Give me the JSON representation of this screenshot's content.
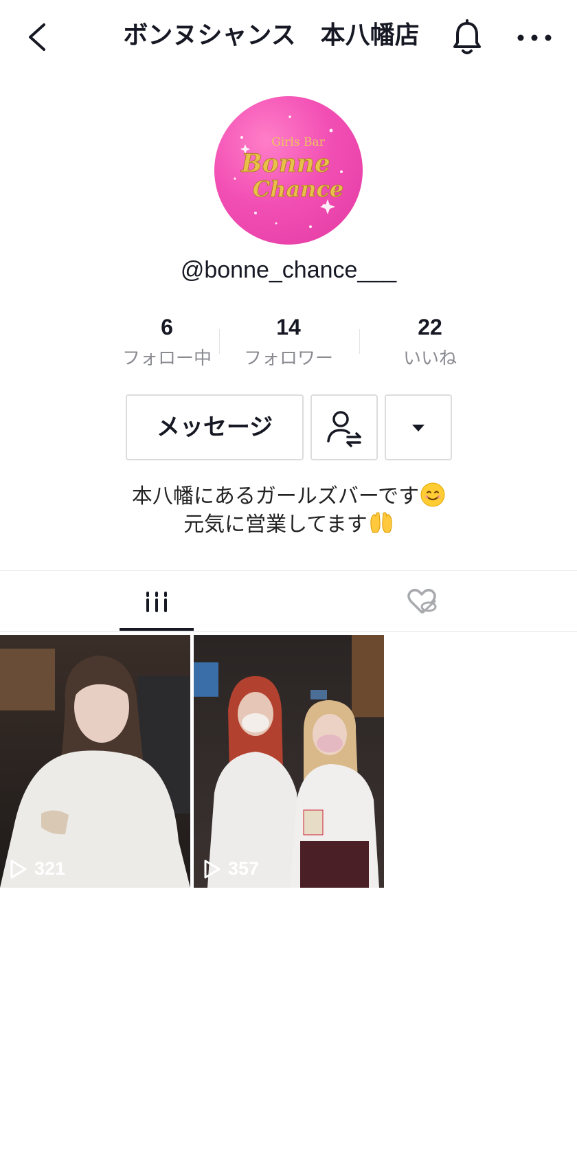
{
  "header": {
    "title": "ボンヌシャンス　本八幡店",
    "back_icon": "chevron-left-icon",
    "bell_icon": "bell-icon",
    "more_icon": "more-dots-icon"
  },
  "profile": {
    "username": "@bonne_chance___",
    "avatar_logo": {
      "line1": "Girls Bar",
      "line2": "Bonne",
      "line3": "Chance"
    }
  },
  "stats": [
    {
      "value": "6",
      "label": "フォロー中"
    },
    {
      "value": "14",
      "label": "フォロワー"
    },
    {
      "value": "22",
      "label": "いいね"
    }
  ],
  "actions": {
    "message_label": "メッセージ",
    "follow_icon": "user-switch-icon",
    "dropdown_icon": "triangle-down-icon"
  },
  "bio": {
    "line1": "本八幡にあるガールズバーです",
    "line2": "元気に営業してます"
  },
  "tabs": {
    "videos_icon": "grid-bars-icon",
    "liked_icon": "hidden-heart-icon"
  },
  "videos": [
    {
      "views": "321"
    },
    {
      "views": "357"
    }
  ],
  "colors": {
    "accent": "#161823",
    "avatar_pink": "#f24fb4",
    "gold": "#e9c04a"
  }
}
